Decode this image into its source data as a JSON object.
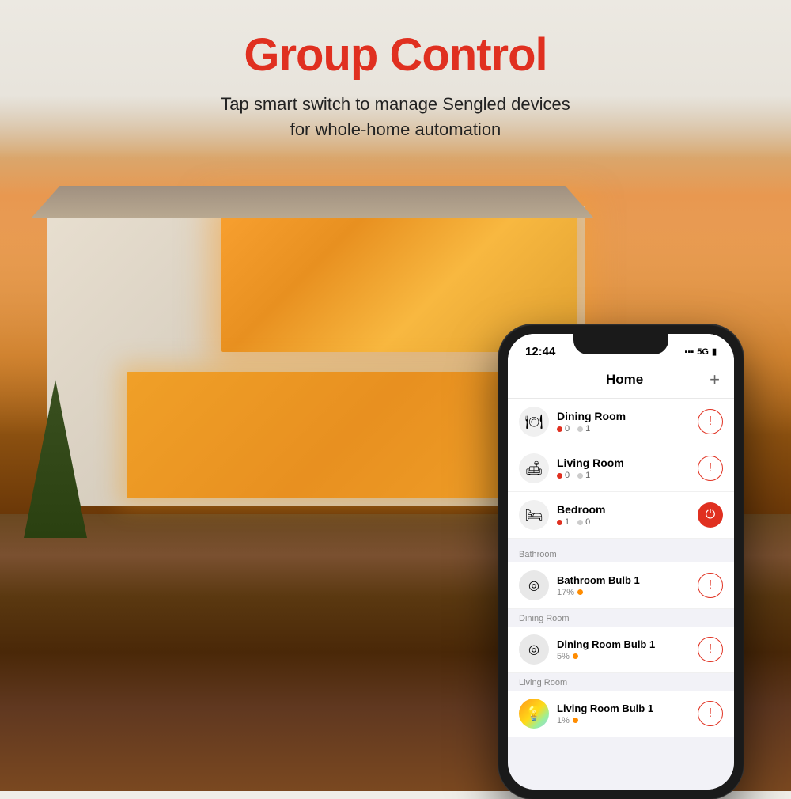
{
  "page": {
    "title": "Group Control",
    "subtitle_line1": "Tap smart switch to manage Sengled devices",
    "subtitle_line2": "for whole-home automation"
  },
  "phone": {
    "status_bar": {
      "time": "12:44",
      "signal": "▲▲▲",
      "network": "5G",
      "battery": "🔋"
    },
    "app_header": {
      "title": "Home",
      "plus_label": "+"
    },
    "rooms": [
      {
        "id": "dining-room",
        "name": "Dining Room",
        "icon": "🍽",
        "stat_off": "0",
        "stat_on": "1",
        "action": "warning"
      },
      {
        "id": "living-room",
        "name": "Living Room",
        "icon": "🛋",
        "stat_off": "0",
        "stat_on": "1",
        "action": "warning"
      },
      {
        "id": "bedroom",
        "name": "Bedroom",
        "icon": "🛏",
        "stat_off": "1",
        "stat_on": "0",
        "action": "power"
      }
    ],
    "device_sections": [
      {
        "section_label": "Bathroom",
        "devices": [
          {
            "id": "bathroom-bulb-1",
            "name": "Bathroom Bulb 1",
            "icon": "⊙",
            "status_text": "17%",
            "status_dot": "orange",
            "action": "warning"
          }
        ]
      },
      {
        "section_label": "Dining Room",
        "devices": [
          {
            "id": "dining-room-bulb-1",
            "name": "Dining Room Bulb 1",
            "icon": "⊙",
            "status_text": "5%",
            "status_dot": "orange",
            "action": "warning"
          }
        ]
      },
      {
        "section_label": "Living Room",
        "devices": [
          {
            "id": "living-room-bulb-1",
            "name": "Living Room Bulb 1",
            "icon": "💡",
            "status_text": "1%",
            "status_dot": "orange",
            "action": "warning"
          }
        ]
      }
    ]
  },
  "colors": {
    "accent": "#e03020",
    "warning": "#e03020",
    "power_on": "#e03020"
  }
}
